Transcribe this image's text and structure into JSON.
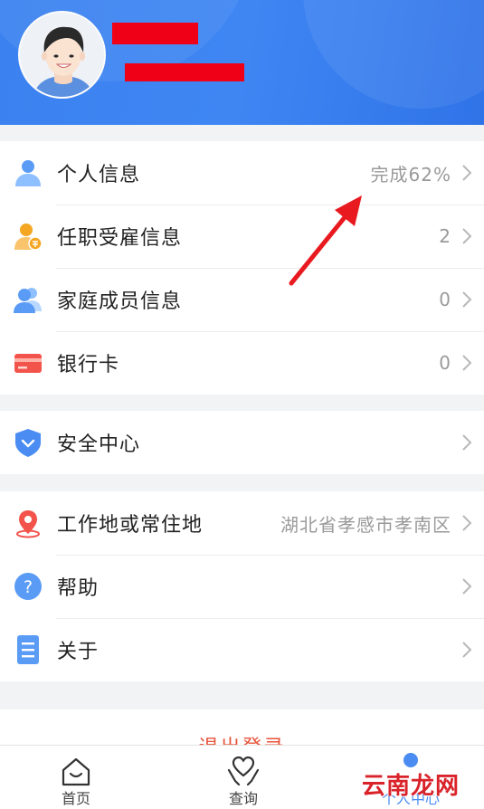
{
  "header": {
    "avatar": "avatar"
  },
  "sections": [
    {
      "items": [
        {
          "label": "个人信息",
          "value": "完成62%",
          "icon": "person-icon"
        },
        {
          "label": "任职受雇信息",
          "value": "2",
          "icon": "employment-person-icon"
        },
        {
          "label": "家庭成员信息",
          "value": "0",
          "icon": "family-members-icon"
        },
        {
          "label": "银行卡",
          "value": "0",
          "icon": "bank-card-icon"
        }
      ]
    },
    {
      "items": [
        {
          "label": "安全中心",
          "value": "",
          "icon": "shield-icon"
        }
      ]
    },
    {
      "items": [
        {
          "label": "工作地或常住地",
          "value": "湖北省孝感市孝南区",
          "icon": "location-pin-icon"
        },
        {
          "label": "帮助",
          "value": "",
          "icon": "help-icon"
        },
        {
          "label": "关于",
          "value": "",
          "icon": "document-icon"
        }
      ]
    }
  ],
  "logout": {
    "label": "退出登录"
  },
  "tabbar": {
    "tabs": [
      {
        "label": "首页",
        "icon": "home-icon"
      },
      {
        "label": "查询",
        "icon": "heart-hands-icon"
      },
      {
        "label": "个人中心",
        "icon": "profile-icon"
      }
    ]
  },
  "watermark": {
    "text": "云南龙网"
  },
  "colors": {
    "brand": "#3b82f0",
    "arrow": "#e8191f",
    "logout": "#e8553a"
  }
}
